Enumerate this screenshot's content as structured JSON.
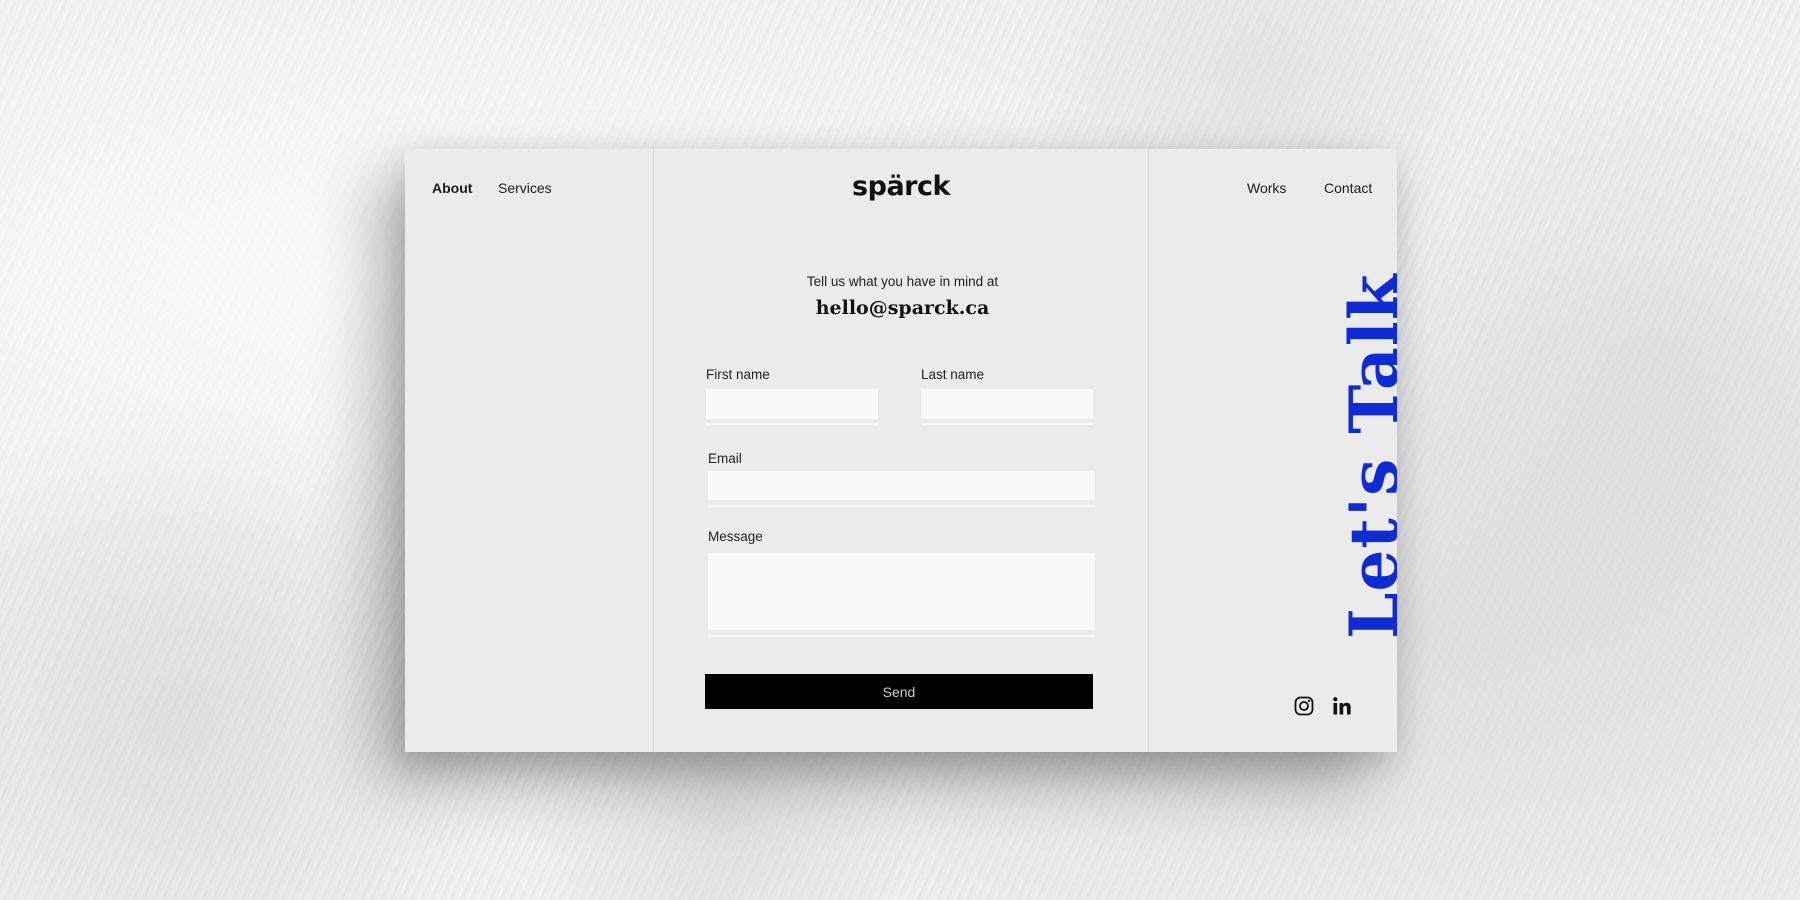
{
  "nav": {
    "left": [
      {
        "label": "About",
        "active": true
      },
      {
        "label": "Services",
        "active": false
      }
    ],
    "right": [
      {
        "label": "Works"
      },
      {
        "label": "Contact"
      }
    ]
  },
  "brand": {
    "logo_text": "spärck"
  },
  "contact": {
    "intro": "Tell us what you have in mind at",
    "email": "hello@sparck.ca"
  },
  "form": {
    "first_name_label": "First name",
    "first_name_value": "",
    "last_name_label": "Last name",
    "last_name_value": "",
    "email_label": "Email",
    "email_value": "",
    "message_label": "Message",
    "message_value": "",
    "send_label": "Send"
  },
  "side_heading": "Let's Talk",
  "social": [
    {
      "icon": "instagram-icon"
    },
    {
      "icon": "linkedin-icon"
    }
  ],
  "colors": {
    "accent": "#0f2bd6",
    "card_bg": "#ebebeb",
    "button_bg": "#000000",
    "input_bg": "#f9f9f9"
  }
}
